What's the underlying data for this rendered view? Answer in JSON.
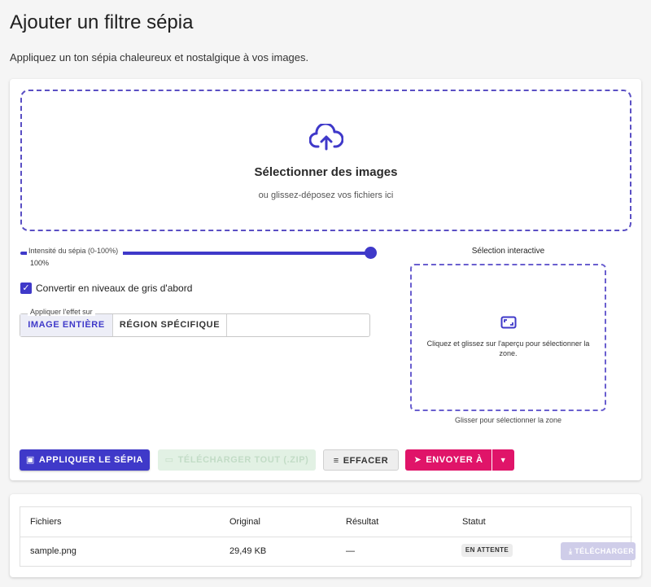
{
  "header": {
    "title": "Ajouter un filtre sépia",
    "subtitle": "Appliquez un ton sépia chaleureux et nostalgique à vos images."
  },
  "dropzone": {
    "icon": "cloud-upload-icon",
    "title": "Sélectionner des images",
    "subtitle": "ou glissez-déposez vos fichiers ici"
  },
  "slider": {
    "label": "Intensité du sépia (0-100%)",
    "value_text": "100%",
    "value": 100
  },
  "grayscale": {
    "label": "Convertir en niveaux de gris d'abord",
    "checked": true
  },
  "apply_to": {
    "legend": "Appliquer l'effet sur",
    "options": [
      "IMAGE ENTIÈRE",
      "RÉGION SPÉCIFIQUE"
    ],
    "selected": "IMAGE ENTIÈRE"
  },
  "selection": {
    "title": "Sélection interactive",
    "icon": "crop-select-icon",
    "instructions": "Cliquez et glissez sur l'aperçu pour sélectionner la zone.",
    "hint": "Glisser pour sélectionner la zone"
  },
  "actions": {
    "apply_label": "APPLIQUER LE SÉPIA",
    "download_all_label": "TÉLÉCHARGER TOUT (.ZIP)",
    "clear_label": "EFFACER",
    "send_label": "ENVOYER À",
    "caret": "▼"
  },
  "table": {
    "columns": [
      "Fichiers",
      "Original",
      "Résultat",
      "Statut"
    ],
    "rows": [
      {
        "file": "sample.png",
        "original": "29,49 KB",
        "result": "—",
        "status": "EN ATTENTE",
        "action": "TÉLÉCHARGER"
      }
    ]
  },
  "colors": {
    "primary": "#3f39c9",
    "accent": "#e01469"
  }
}
